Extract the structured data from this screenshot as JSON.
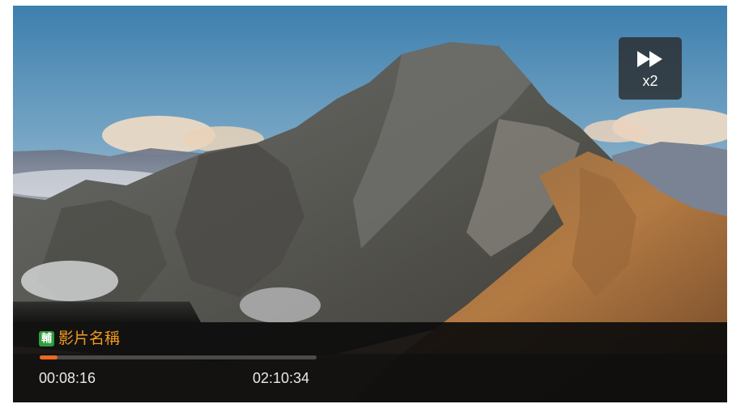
{
  "player": {
    "speed_label": "x2",
    "subtitle_badge": "輔",
    "title": "影片名稱",
    "current_time": "00:08:16",
    "total_time": "02:10:34",
    "progress_fraction": 0.063
  },
  "icons": {
    "speed": "fast-forward-icon",
    "subtitle": "subtitle-badge-icon"
  },
  "colors": {
    "title_text": "#f39a1e",
    "progress_fill": "#ec6a1f",
    "progress_track": "#4a4a4a",
    "subtitle_badge": "#2f9d3c",
    "panel_background": "#0c0c0c"
  }
}
